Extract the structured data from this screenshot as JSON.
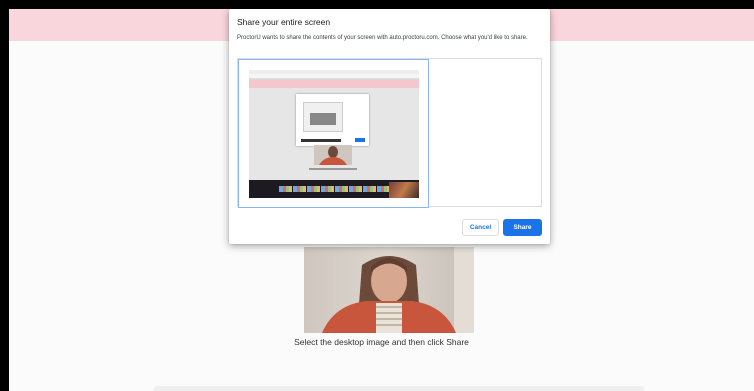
{
  "page": {
    "instruction": "Select the desktop image and then click Share"
  },
  "dialog": {
    "title": "Share your entire screen",
    "description": "ProctorU wants to share the contents of your screen with auto.proctoru.com. Choose what you'd like to share.",
    "cancel_label": "Cancel",
    "share_label": "Share"
  },
  "colors": {
    "banner": "#f9d6db",
    "accent": "#1a73e8",
    "selection_border": "#8ab4f8"
  }
}
